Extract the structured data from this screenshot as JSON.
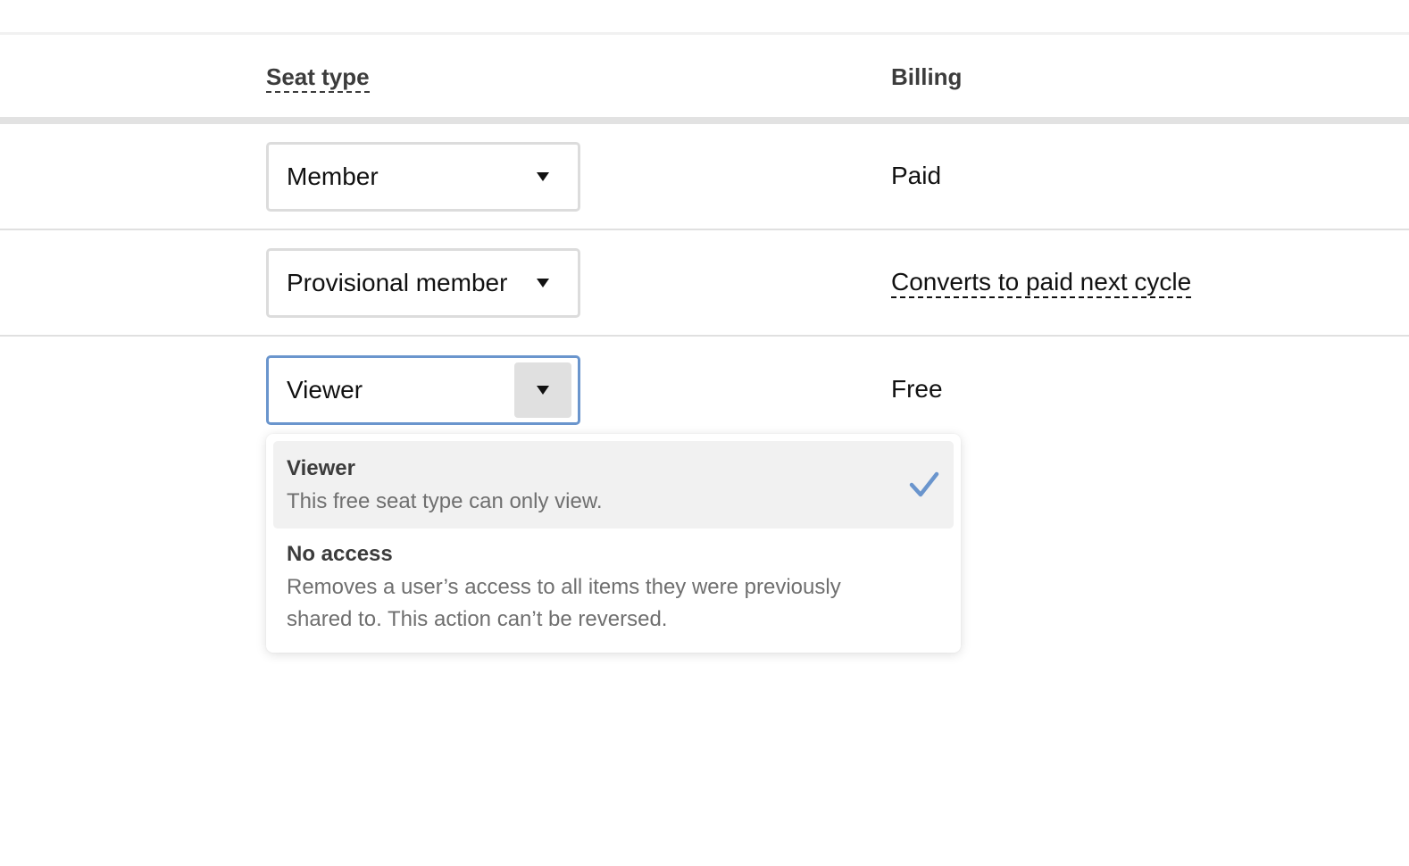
{
  "table": {
    "headers": {
      "seat_type": "Seat type",
      "billing": "Billing"
    },
    "rows": [
      {
        "seat_type": "Member",
        "billing": "Paid"
      },
      {
        "seat_type": "Provisional member",
        "billing": "Converts to paid next cycle"
      },
      {
        "seat_type": "Viewer",
        "billing": "Free"
      }
    ]
  },
  "dropdown": {
    "open_row": 3,
    "options": [
      {
        "title": "Viewer",
        "description": "This free seat type can only view.",
        "selected": true
      },
      {
        "title": "No access",
        "description": "Removes a user’s access to all items they were previously shared to. This action can’t be reversed.",
        "selected": false
      }
    ]
  },
  "colors": {
    "focus_border": "#6a95cd",
    "check": "#6a95cd",
    "selected_option_bg": "#f1f1f1",
    "header_rule": "#e2e2e2"
  },
  "icons": {
    "select_caret": "caret-down-icon",
    "selected_check": "checkmark-icon"
  }
}
